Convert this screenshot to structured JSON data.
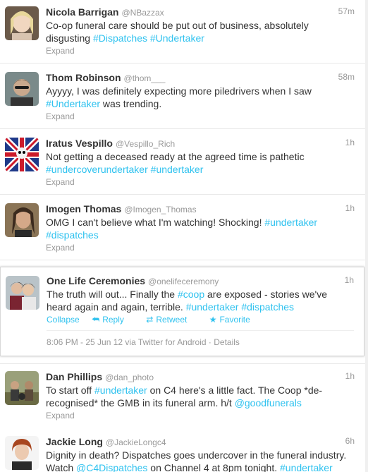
{
  "colors": {
    "link": "#2fc2ef",
    "muted": "#999999",
    "text": "#333333"
  },
  "tweets": [
    {
      "fullname": "Nicola Barrigan",
      "username": "@NBazzax",
      "time": "57m",
      "line1": "Co-op funeral care should be put out of business, absolutely",
      "line2a": "disgusting ",
      "tag1": "#Dispatches",
      "tag2": "#Undertaker",
      "expand": "Expand"
    },
    {
      "fullname": "Thom Robinson",
      "username": "@thom___",
      "time": "58m",
      "line1": "Ayyyy, I was definitely expecting more piledrivers when I saw",
      "tag1": "#Undertaker",
      "line2b": " was trending.",
      "expand": "Expand"
    },
    {
      "fullname": "Iratus Vespillo",
      "username": "@Vespillo_Rich",
      "time": "1h",
      "line1": "Not getting a deceased ready at the agreed time is pathetic",
      "tag1": "#undercoverundertaker",
      "tag2": "#undertaker",
      "expand": "Expand"
    },
    {
      "fullname": "Imogen Thomas",
      "username": "@Imogen_Thomas",
      "time": "1h",
      "line1a": "OMG I can't believe what I'm watching! Shocking! ",
      "tag1": "#undertaker",
      "tag2": "#dispatches",
      "expand": "Expand"
    },
    {
      "fullname": "One Life Ceremonies",
      "username": "@onelifeceremony",
      "time": "1h",
      "line1a": "The truth will out... Finally the ",
      "tag1": "#coop",
      "line1b": " are exposed - stories we've",
      "line2a": "heard again and again, terrible. ",
      "tag2": "#undertaker",
      "tag3": "#dispatches",
      "actions": {
        "collapse": "Collapse",
        "reply": "Reply",
        "retweet": "Retweet",
        "favorite": "Favorite"
      },
      "meta": "8:06 PM - 25 Jun 12 via Twitter for Android · Details"
    },
    {
      "fullname": "Dan Phillips",
      "username": "@dan_photo",
      "time": "1h",
      "line1a": "To start off ",
      "tag1": "#undertaker",
      "line1b": " on C4 here's a little fact. The Coop *de-",
      "line2a": "recognised* the GMB in its funeral arm. h/t ",
      "tag2": "@goodfunerals",
      "expand": "Expand"
    },
    {
      "fullname": "Jackie Long",
      "username": "@JackieLongc4",
      "time": "6h",
      "line1": "Dignity in death? Dispatches goes undercover in the funeral industry.",
      "line2a": "Watch ",
      "tag1": "@C4Dispatches",
      "line2b": " on Channel 4 at 8pm tonight. ",
      "tag2": "#undertaker"
    }
  ]
}
